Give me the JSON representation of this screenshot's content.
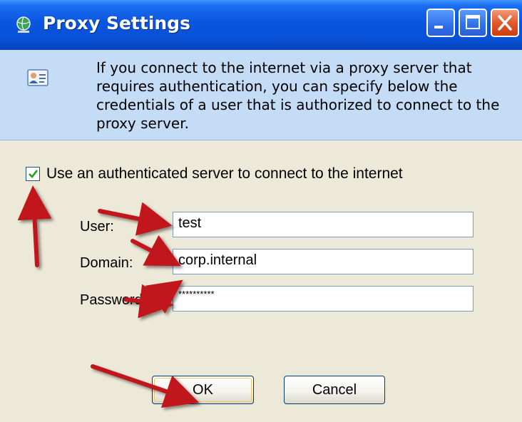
{
  "window": {
    "title": "Proxy Settings",
    "title_icon": "globe-network-icon",
    "controls": {
      "minimize_icon": "minimize-icon",
      "maximize_icon": "maximize-icon",
      "close_icon": "close-icon"
    }
  },
  "header": {
    "icon": "user-card-icon",
    "text": "If you connect to the internet via a proxy server that requires authentication, you can specify below the credentials of a user that is authorized to connect to the proxy server."
  },
  "auth": {
    "checkbox_label": "Use an authenticated server to connect to the internet",
    "checked": true,
    "user_label": "User:",
    "user_value": "test",
    "domain_label": "Domain:",
    "domain_value": "corp.internal",
    "password_label": "Password:",
    "password_value": "**********"
  },
  "buttons": {
    "ok_label": "OK",
    "cancel_label": "Cancel"
  },
  "annotations": {
    "arrow_color": "#c0161c",
    "count": 6
  },
  "colors": {
    "titlebar": "#0a55e0",
    "header_panel": "#c5dcf6",
    "dialog_body": "#ece9d8"
  }
}
